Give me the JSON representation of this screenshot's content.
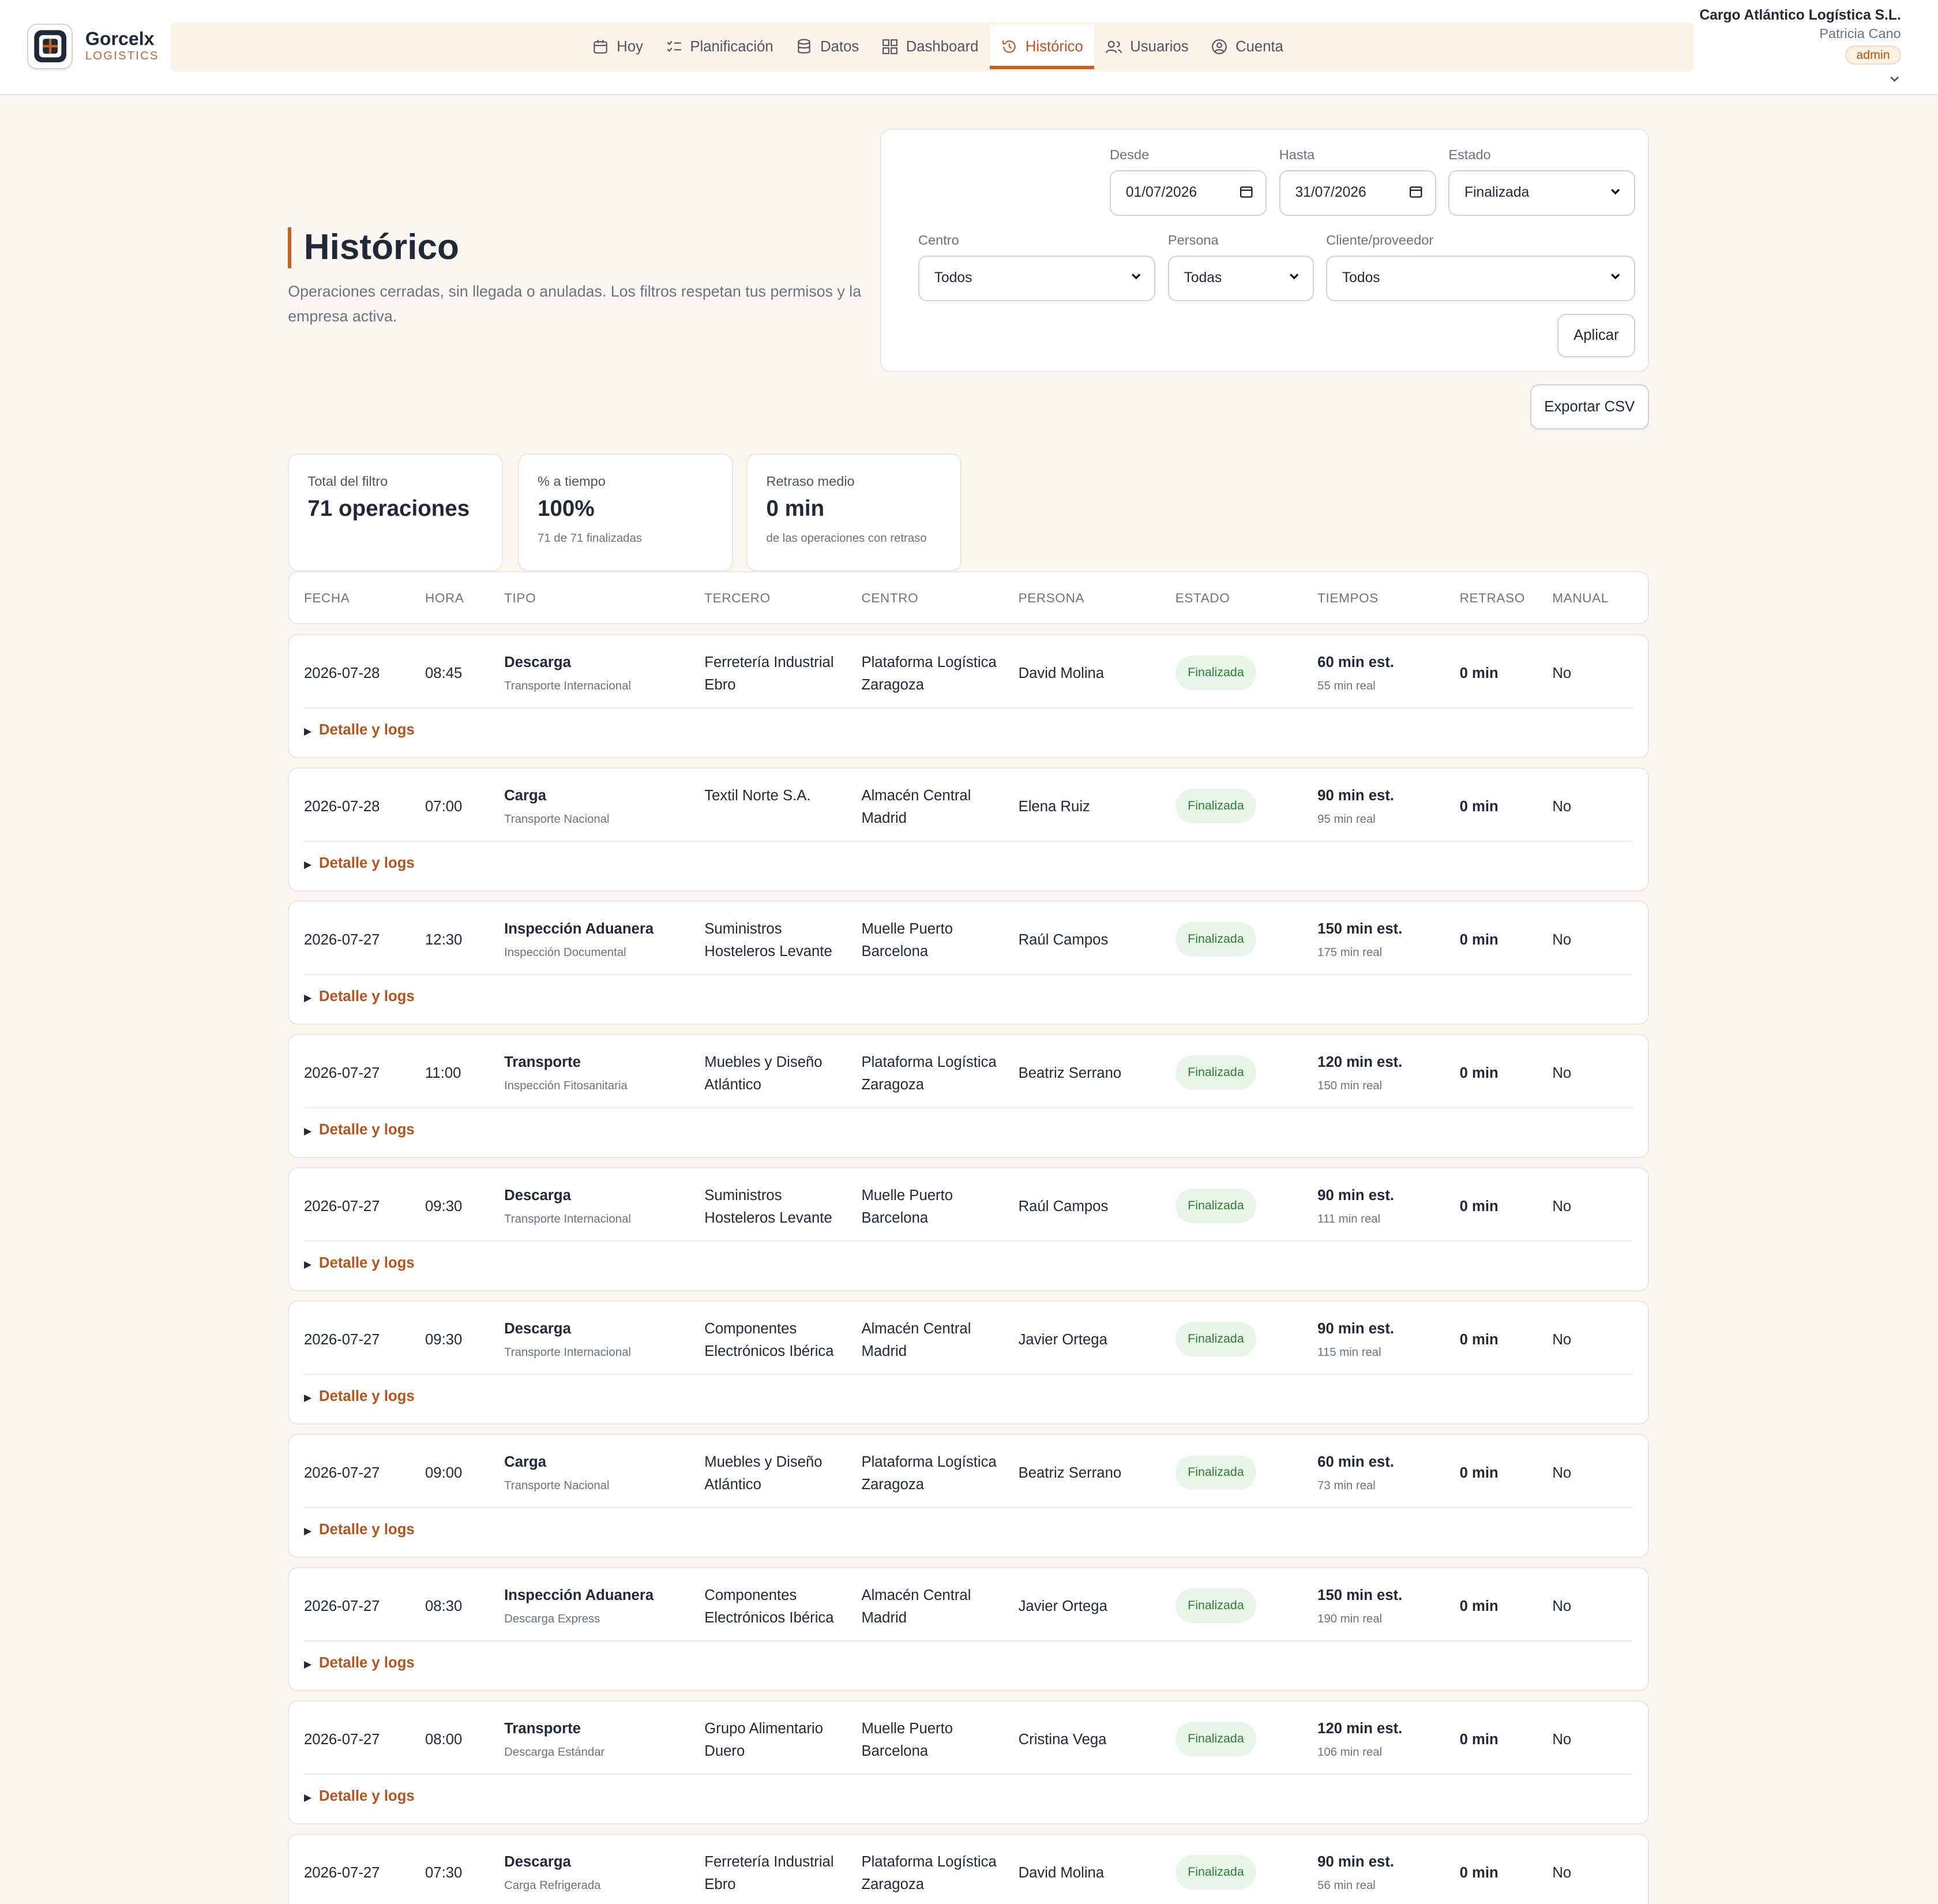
{
  "brand": {
    "name": "Gorcelx",
    "sub": "LOGISTICS"
  },
  "nav": [
    {
      "label": "Hoy",
      "icon": "calendar-icon",
      "active": false
    },
    {
      "label": "Planificación",
      "icon": "checklist-icon",
      "active": false
    },
    {
      "label": "Datos",
      "icon": "database-icon",
      "active": false
    },
    {
      "label": "Dashboard",
      "icon": "grid-icon",
      "active": false
    },
    {
      "label": "Histórico",
      "icon": "history-icon",
      "active": true
    },
    {
      "label": "Usuarios",
      "icon": "users-icon",
      "active": false
    },
    {
      "label": "Cuenta",
      "icon": "user-circle-icon",
      "active": false
    }
  ],
  "account": {
    "company": "Cargo Atlántico Logística S.L.",
    "user": "Patricia Cano",
    "role": "admin"
  },
  "page": {
    "title": "Histórico",
    "description": "Operaciones cerradas, sin llegada o anuladas. Los filtros respetan tus permisos y la empresa activa."
  },
  "filters": {
    "desde_label": "Desde",
    "desde_value": "01/07/2026",
    "hasta_label": "Hasta",
    "hasta_value": "31/07/2026",
    "estado_label": "Estado",
    "estado_value": "Finalizada",
    "centro_label": "Centro",
    "centro_value": "Todos",
    "persona_label": "Persona",
    "persona_value": "Todas",
    "cliente_label": "Cliente/proveedor",
    "cliente_value": "Todos",
    "apply_label": "Aplicar",
    "export_label": "Exportar CSV"
  },
  "stats": [
    {
      "label": "Total del filtro",
      "value": "71 operaciones",
      "sub": ""
    },
    {
      "label": "% a tiempo",
      "value": "100%",
      "sub": "71 de 71 finalizadas"
    },
    {
      "label": "Retraso medio",
      "value": "0 min",
      "sub": "de las operaciones con retraso"
    }
  ],
  "table": {
    "headers": [
      "FECHA",
      "HORA",
      "TIPO",
      "TERCERO",
      "CENTRO",
      "PERSONA",
      "ESTADO",
      "TIEMPOS",
      "RETRASO",
      "MANUAL"
    ],
    "detail_label": "Detalle y logs",
    "rows": [
      {
        "fecha": "2026-07-28",
        "hora": "08:45",
        "tipo": "Descarga",
        "subtipo": "Transporte Internacional",
        "tercero_1": "Ferretería Industrial",
        "tercero_2": "Ebro",
        "centro_1": "Plataforma Logística",
        "centro_2": "Zaragoza",
        "persona": "David Molina",
        "estado": "Finalizada",
        "est": "60 min est.",
        "real": "55 min real",
        "retraso": "0 min",
        "manual": "No"
      },
      {
        "fecha": "2026-07-28",
        "hora": "07:00",
        "tipo": "Carga",
        "subtipo": "Transporte Nacional",
        "tercero_1": "Textil Norte S.A.",
        "tercero_2": "",
        "centro_1": "Almacén Central",
        "centro_2": "Madrid",
        "persona": "Elena Ruiz",
        "estado": "Finalizada",
        "est": "90 min est.",
        "real": "95 min real",
        "retraso": "0 min",
        "manual": "No"
      },
      {
        "fecha": "2026-07-27",
        "hora": "12:30",
        "tipo": "Inspección Aduanera",
        "subtipo": "Inspección Documental",
        "tercero_1": "Suministros",
        "tercero_2": "Hosteleros Levante",
        "centro_1": "Muelle Puerto",
        "centro_2": "Barcelona",
        "persona": "Raúl Campos",
        "estado": "Finalizada",
        "est": "150 min est.",
        "real": "175 min real",
        "retraso": "0 min",
        "manual": "No"
      },
      {
        "fecha": "2026-07-27",
        "hora": "11:00",
        "tipo": "Transporte",
        "subtipo": "Inspección Fitosanitaria",
        "tercero_1": "Muebles y Diseño",
        "tercero_2": "Atlántico",
        "centro_1": "Plataforma Logística",
        "centro_2": "Zaragoza",
        "persona": "Beatriz Serrano",
        "estado": "Finalizada",
        "est": "120 min est.",
        "real": "150 min real",
        "retraso": "0 min",
        "manual": "No"
      },
      {
        "fecha": "2026-07-27",
        "hora": "09:30",
        "tipo": "Descarga",
        "subtipo": "Transporte Internacional",
        "tercero_1": "Suministros",
        "tercero_2": "Hosteleros Levante",
        "centro_1": "Muelle Puerto",
        "centro_2": "Barcelona",
        "persona": "Raúl Campos",
        "estado": "Finalizada",
        "est": "90 min est.",
        "real": "111 min real",
        "retraso": "0 min",
        "manual": "No"
      },
      {
        "fecha": "2026-07-27",
        "hora": "09:30",
        "tipo": "Descarga",
        "subtipo": "Transporte Internacional",
        "tercero_1": "Componentes",
        "tercero_2": "Electrónicos Ibérica",
        "centro_1": "Almacén Central",
        "centro_2": "Madrid",
        "persona": "Javier Ortega",
        "estado": "Finalizada",
        "est": "90 min est.",
        "real": "115 min real",
        "retraso": "0 min",
        "manual": "No"
      },
      {
        "fecha": "2026-07-27",
        "hora": "09:00",
        "tipo": "Carga",
        "subtipo": "Transporte Nacional",
        "tercero_1": "Muebles y Diseño",
        "tercero_2": "Atlántico",
        "centro_1": "Plataforma Logística",
        "centro_2": "Zaragoza",
        "persona": "Beatriz Serrano",
        "estado": "Finalizada",
        "est": "60 min est.",
        "real": "73 min real",
        "retraso": "0 min",
        "manual": "No"
      },
      {
        "fecha": "2026-07-27",
        "hora": "08:30",
        "tipo": "Inspección Aduanera",
        "subtipo": "Descarga Express",
        "tercero_1": "Componentes",
        "tercero_2": "Electrónicos Ibérica",
        "centro_1": "Almacén Central",
        "centro_2": "Madrid",
        "persona": "Javier Ortega",
        "estado": "Finalizada",
        "est": "150 min est.",
        "real": "190 min real",
        "retraso": "0 min",
        "manual": "No"
      },
      {
        "fecha": "2026-07-27",
        "hora": "08:00",
        "tipo": "Transporte",
        "subtipo": "Descarga Estándar",
        "tercero_1": "Grupo Alimentario",
        "tercero_2": "Duero",
        "centro_1": "Muelle Puerto",
        "centro_2": "Barcelona",
        "persona": "Cristina Vega",
        "estado": "Finalizada",
        "est": "120 min est.",
        "real": "106 min real",
        "retraso": "0 min",
        "manual": "No"
      },
      {
        "fecha": "2026-07-27",
        "hora": "07:30",
        "tipo": "Descarga",
        "subtipo": "Carga Refrigerada",
        "tercero_1": "Ferretería Industrial",
        "tercero_2": "Ebro",
        "centro_1": "Plataforma Logística",
        "centro_2": "Zaragoza",
        "persona": "David Molina",
        "estado": "Finalizada",
        "est": "90 min est.",
        "real": "56 min real",
        "retraso": "0 min",
        "manual": "No"
      }
    ]
  }
}
